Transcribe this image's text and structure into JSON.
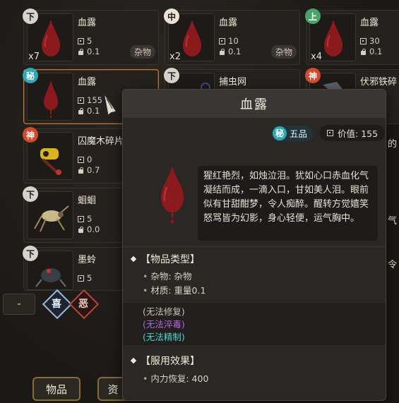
{
  "inventory": {
    "cards": [
      {
        "grade": "下",
        "name": "血露",
        "value": "5",
        "weight": "0.1",
        "count": "x7",
        "tag": "杂物"
      },
      {
        "grade": "中",
        "name": "血露",
        "value": "10",
        "weight": "0.1",
        "count": "x2",
        "tag": "杂物"
      },
      {
        "grade": "上",
        "name": "血露",
        "value": "30",
        "weight": "0.1",
        "count": "x4",
        "tag": ""
      },
      {
        "grade": "秘",
        "name": "血露",
        "value": "155",
        "weight": "0.1",
        "count": "",
        "tag": ""
      },
      {
        "grade": "下",
        "name": "捕虫网",
        "value": "",
        "weight": "",
        "count": "",
        "tag": ""
      },
      {
        "grade": "神",
        "name": "伏邪铁碎",
        "value": "",
        "weight": "",
        "count": "",
        "tag": ""
      },
      {
        "grade": "神",
        "name": "囚魔木碎片",
        "value": "0",
        "weight": "0.7",
        "count": "",
        "tag": ""
      },
      {
        "grade": "下",
        "name": "蛔蛔",
        "value": "5",
        "weight": "0.0",
        "count": "",
        "tag": ""
      },
      {
        "grade": "下",
        "name": "墨蛉",
        "value": "5",
        "weight": "",
        "count": "",
        "tag": ""
      }
    ],
    "partial_right": [
      "的",
      "气",
      "令"
    ]
  },
  "controls": {
    "minus_left": "-",
    "xi": "喜",
    "e": "恶",
    "tabs": [
      "物品",
      "资"
    ]
  },
  "tooltip": {
    "title": "血露",
    "grade_label": "秘",
    "grade_text": "五品",
    "value_label": "价值: 155",
    "description": "猩红艳烈，如烛泣泪。犹如心口赤血化气凝结而成，一滴入口，甘如美人泪。眼前似有甘甜酣梦，令人痴醉。醒转方觉嬉笑怒骂皆为幻影，身心轻便，运气胸中。",
    "section1_title": "【物品类型】",
    "section1_lines": [
      "杂物: 杂物",
      "材质: 重量0.1"
    ],
    "flags": [
      "(无法修复)",
      "(无法淬毒)",
      "(无法精制)"
    ],
    "section2_title": "【服用效果】",
    "section2_lines": [
      "内力恢复: 400"
    ]
  },
  "colors": {
    "accent_border": "#c07a3a",
    "grade_mi": "#2fa8b4",
    "grade_shen": "#d24a2e",
    "grade_shang": "#4aa36a",
    "flag_purple": "#b066e0",
    "flag_cyan": "#4ad4cf",
    "blood_red": "#8b1a1f"
  },
  "icons": [
    "blood-drop-icon",
    "value-icon",
    "weight-icon",
    "net-icon",
    "iron-shard-icon",
    "wood-shard-icon",
    "cricket-icon",
    "beetle-icon",
    "cursor-quill-icon"
  ]
}
